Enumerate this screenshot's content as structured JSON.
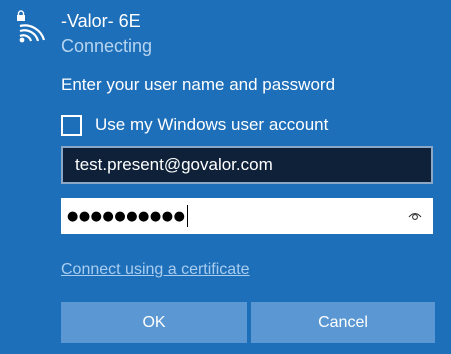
{
  "network": {
    "name": "-Valor- 6E",
    "status": "Connecting",
    "icon": "wifi-secured-icon"
  },
  "form": {
    "prompt": "Enter your user name and password",
    "use_windows_account_label": "Use my Windows user account",
    "use_windows_account_checked": false,
    "username_value": "test.present@govalor.com",
    "password_masked": "●●●●●●●●●●",
    "reveal_icon": "eye-icon"
  },
  "links": {
    "certificate": "Connect using a certificate"
  },
  "buttons": {
    "ok": "OK",
    "cancel": "Cancel"
  },
  "colors": {
    "background": "#1e6fba",
    "status_text": "#b7d4ef",
    "link": "#a9cdef",
    "button": "#5b98d3",
    "username_field_bg": "#0f2139"
  }
}
